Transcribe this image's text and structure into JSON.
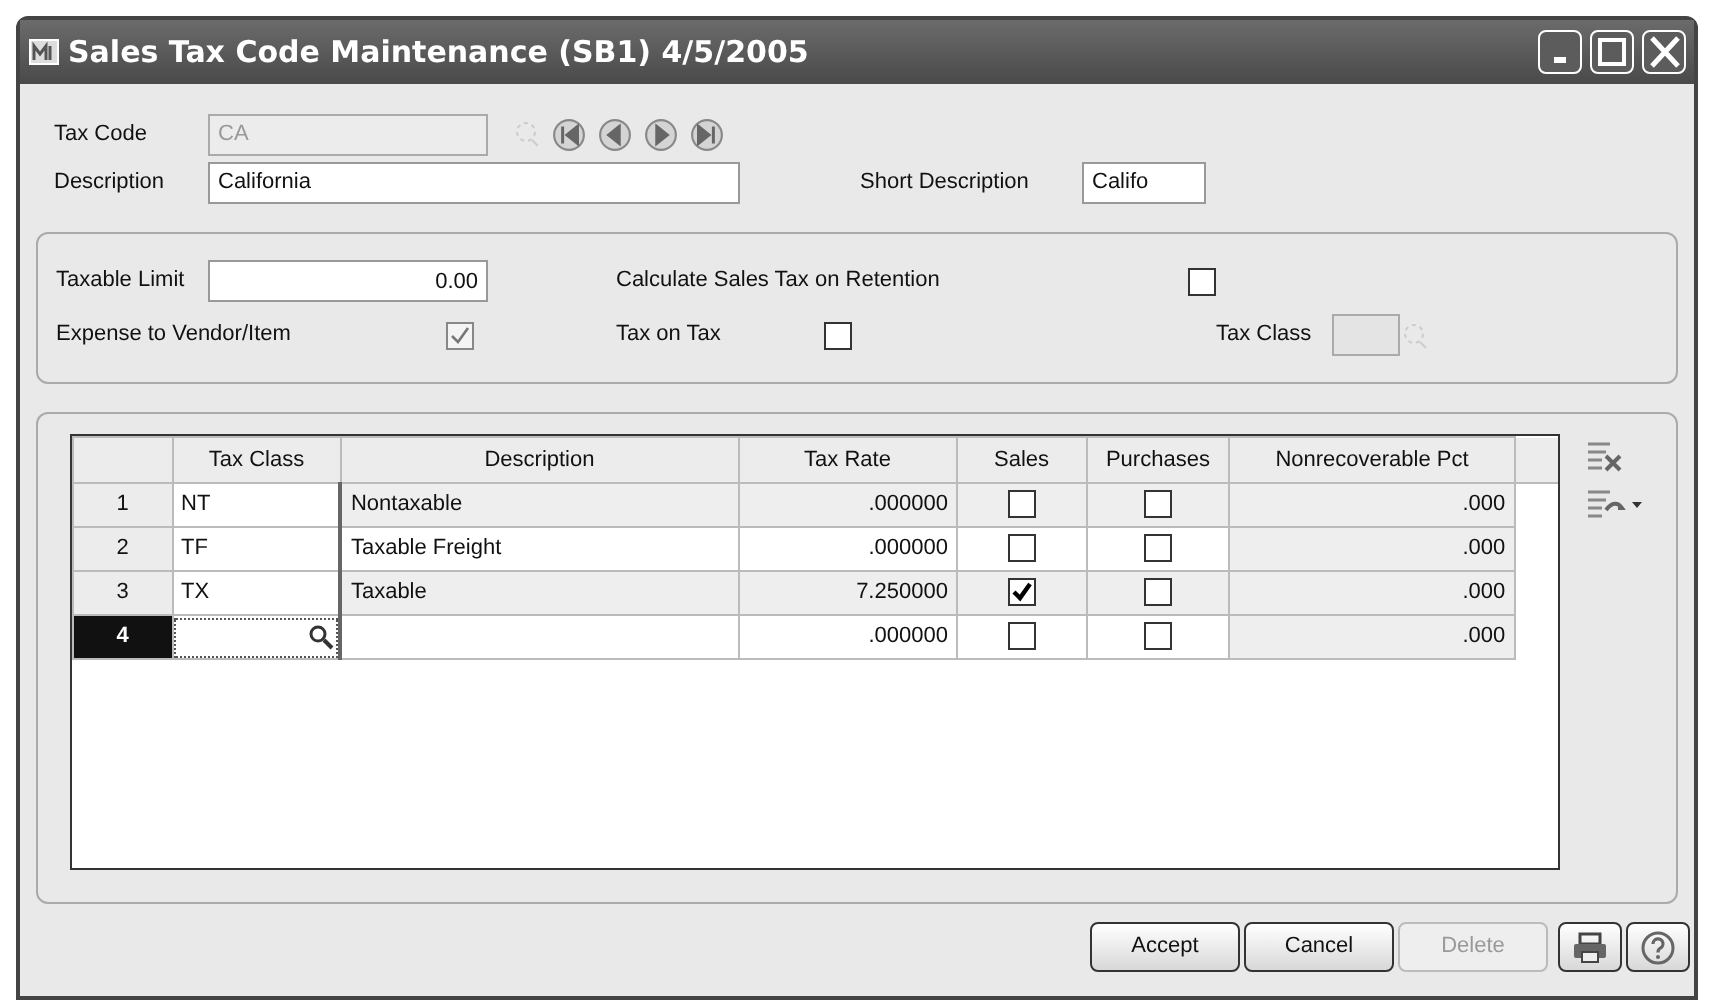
{
  "window": {
    "title": "Sales Tax Code Maintenance (SB1) 4/5/2005"
  },
  "header": {
    "tax_code": {
      "label": "Tax Code",
      "value": "CA",
      "disabled": true
    },
    "description": {
      "label": "Description",
      "value": "California"
    },
    "short_description": {
      "label": "Short Description",
      "value": "Califo"
    }
  },
  "options": {
    "taxable_limit": {
      "label": "Taxable Limit",
      "value": "0.00"
    },
    "expense_to_vendor": {
      "label": "Expense to Vendor/Item",
      "checked": true,
      "disabled": true
    },
    "calc_on_retention": {
      "label": "Calculate Sales Tax on Retention",
      "checked": false
    },
    "tax_on_tax": {
      "label": "Tax on Tax",
      "checked": false
    },
    "tax_class": {
      "label": "Tax Class",
      "disabled": true
    }
  },
  "table": {
    "columns": [
      "Tax Class",
      "Description",
      "Tax Rate",
      "Sales",
      "Purchases",
      "Nonrecoverable Pct"
    ],
    "rows": [
      {
        "number": "1",
        "tax_class": "NT",
        "description": "Nontaxable",
        "tax_rate": ".000000",
        "sales": false,
        "purchases": false,
        "nonrecoverable_pct": ".000",
        "selected": false
      },
      {
        "number": "2",
        "tax_class": "TF",
        "description": "Taxable Freight",
        "tax_rate": ".000000",
        "sales": false,
        "purchases": false,
        "nonrecoverable_pct": ".000",
        "selected": false
      },
      {
        "number": "3",
        "tax_class": "TX",
        "description": "Taxable",
        "tax_rate": "7.250000",
        "sales": true,
        "purchases": false,
        "nonrecoverable_pct": ".000",
        "selected": false
      },
      {
        "number": "4",
        "tax_class": "",
        "description": "",
        "tax_rate": ".000000",
        "sales": false,
        "purchases": false,
        "nonrecoverable_pct": ".000",
        "selected": true
      }
    ]
  },
  "buttons": [
    {
      "label": "Accept",
      "disabled": false
    },
    {
      "label": "Cancel",
      "disabled": false
    },
    {
      "label": "Delete",
      "disabled": true
    }
  ]
}
